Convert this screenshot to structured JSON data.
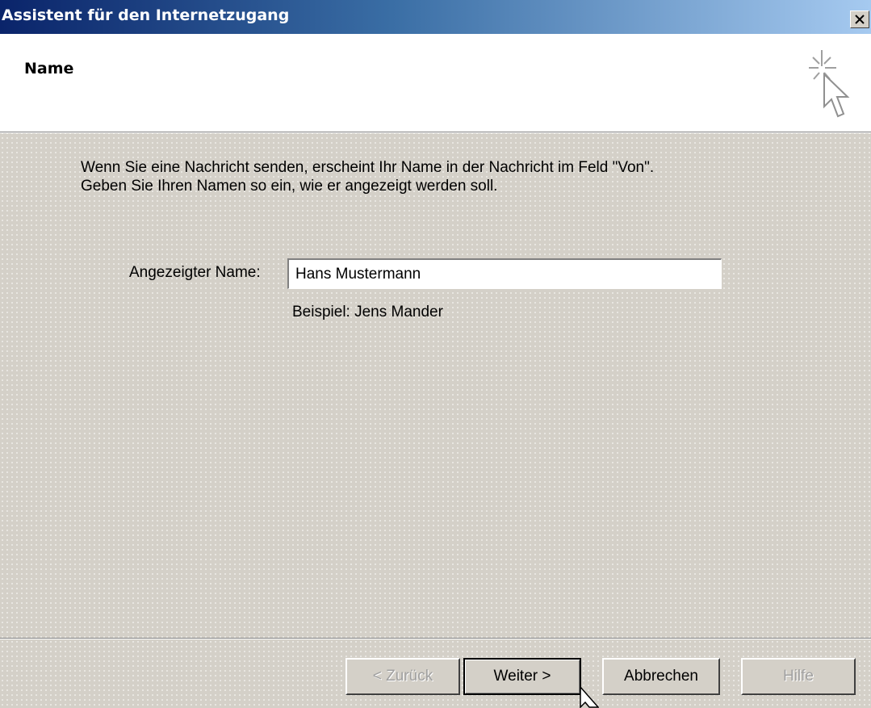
{
  "window": {
    "title": "Assistent für den Internetzugang"
  },
  "header": {
    "title": "Name",
    "icon": "wizard-sparkle-cursor-icon"
  },
  "body": {
    "description_line1": "Wenn Sie eine Nachricht senden, erscheint Ihr Name in der Nachricht im Feld \"Von\".",
    "description_line2": "Geben Sie Ihren Namen so ein, wie er angezeigt werden soll.",
    "field_label": "Angezeigter Name:",
    "field_value": "Hans Mustermann",
    "example": "Beispiel: Jens Mander"
  },
  "buttons": {
    "back": "< Zurück",
    "next": "Weiter >",
    "cancel": "Abbrechen",
    "help": "Hilfe"
  },
  "colors": {
    "titlebar_start": "#0a246a",
    "titlebar_end": "#a6caf0",
    "dialog_face": "#d4d0c8"
  }
}
